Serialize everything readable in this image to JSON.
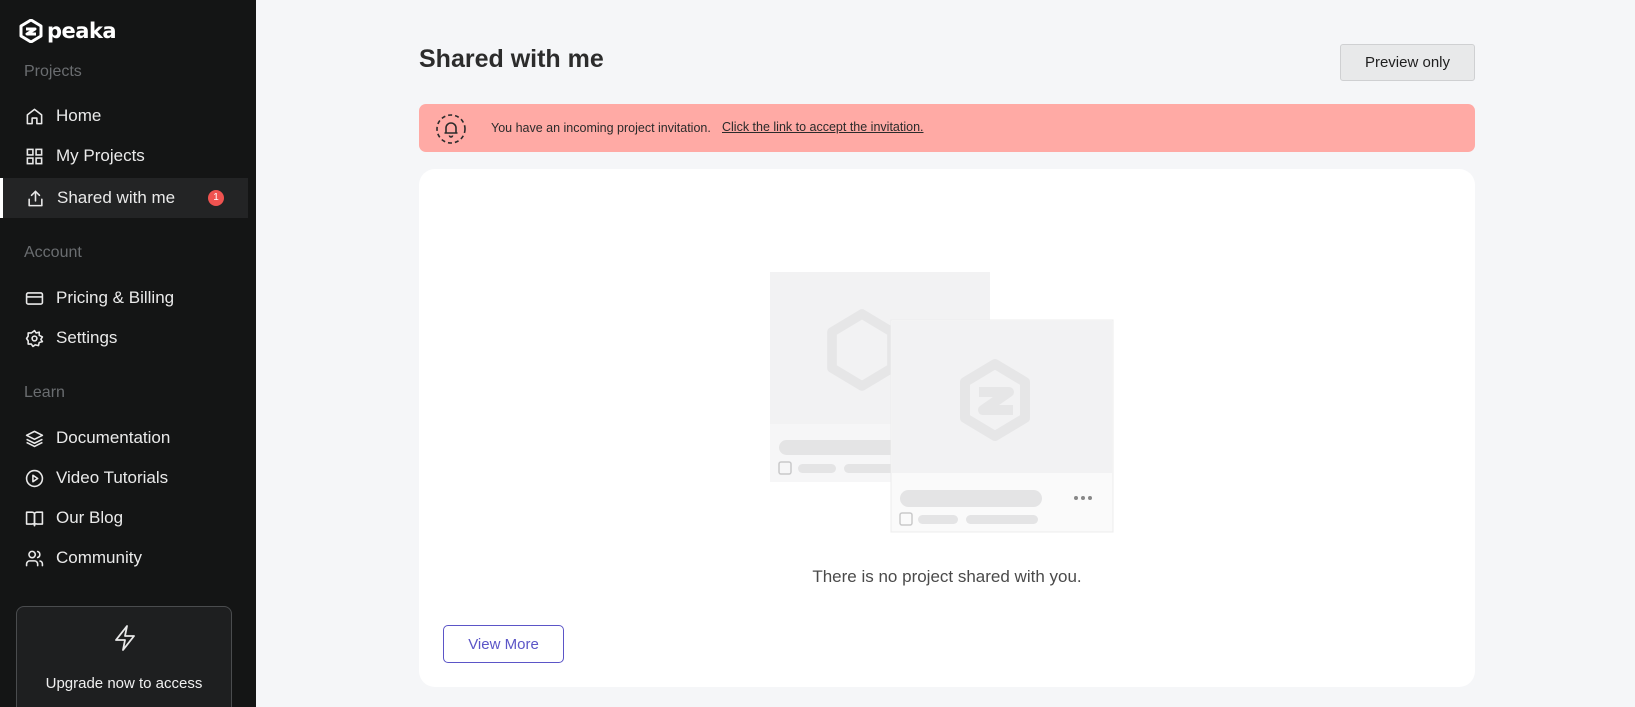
{
  "app": {
    "logo_text": "peaka"
  },
  "sidebar": {
    "sections": {
      "projects": "Projects",
      "account": "Account",
      "learn": "Learn"
    },
    "items": [
      {
        "label": "Home",
        "icon": "home-icon"
      },
      {
        "label": "My Projects",
        "icon": "grid-icon"
      },
      {
        "label": "Shared with me",
        "icon": "share-icon",
        "active": true,
        "badge": "1"
      },
      {
        "label": "Pricing & Billing",
        "icon": "credit-card-icon"
      },
      {
        "label": "Settings",
        "icon": "gear-icon"
      },
      {
        "label": "Documentation",
        "icon": "layers-icon"
      },
      {
        "label": "Video Tutorials",
        "icon": "play-circle-icon"
      },
      {
        "label": "Our Blog",
        "icon": "book-icon"
      },
      {
        "label": "Community",
        "icon": "users-icon"
      }
    ],
    "upgrade": {
      "text": "Upgrade now to access",
      "icon": "bolt-icon"
    }
  },
  "main": {
    "title": "Shared with me",
    "preview_button": "Preview only",
    "banner": {
      "text": "You have an incoming project invitation.",
      "link": "Click the link to accept the invitation.",
      "icon": "bell-icon"
    },
    "empty_text": "There is no project shared with you.",
    "view_more": "View More"
  },
  "colors": {
    "sidebar_bg": "#141515",
    "banner_bg": "#ffaaa5",
    "badge": "#ef5350",
    "accent": "#5b55c7"
  }
}
